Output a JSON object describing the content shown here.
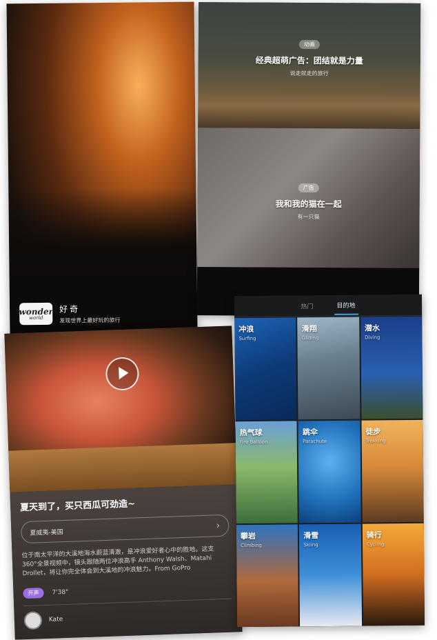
{
  "panel1": {
    "logo_line1": "wonder",
    "logo_line2": "world",
    "brand_name": "好奇",
    "brand_tagline": "发现世界上最好玩的旅行"
  },
  "panel2": {
    "items": [
      {
        "tag": "动画",
        "title": "经典超萌广告：团结就是力量",
        "subtitle": "说走就走的旅行"
      },
      {
        "tag": "广告",
        "title": "我和我的猫在一起",
        "subtitle": "有一只猫"
      }
    ]
  },
  "panel3": {
    "title": "夏天到了，买只西瓜可劲造~",
    "location": "夏威夷-美国",
    "description": "位于南太平洋的大溪地海水蔚蓝清澈，是冲浪爱好者心中的胜地。这支 360°全景视频中，镜头跟随两位冲浪高手 Anthony Walsh、Matahi Drollet，将让你完全体会到大溪地的冲浪魅力。From GoPro",
    "tag": "开声",
    "duration": "7'38\"",
    "user": "Kate"
  },
  "panel4": {
    "tabs": [
      "热门",
      "目的地"
    ],
    "active_tab": "目的地",
    "tiles": [
      {
        "zh": "冲浪",
        "en": "Surfing"
      },
      {
        "zh": "滑翔",
        "en": "Gliding"
      },
      {
        "zh": "潜水",
        "en": "Diving"
      },
      {
        "zh": "热气球",
        "en": "Fire Balloon"
      },
      {
        "zh": "跳伞",
        "en": "Parachute"
      },
      {
        "zh": "徒步",
        "en": "Trekking"
      },
      {
        "zh": "攀岩",
        "en": "Climbing"
      },
      {
        "zh": "滑雪",
        "en": "Skiing"
      },
      {
        "zh": "骑行",
        "en": "Cycling"
      }
    ]
  },
  "colors": {
    "accent_tab": "#3aa0d8",
    "tag_purple": "#9b6fe0"
  }
}
